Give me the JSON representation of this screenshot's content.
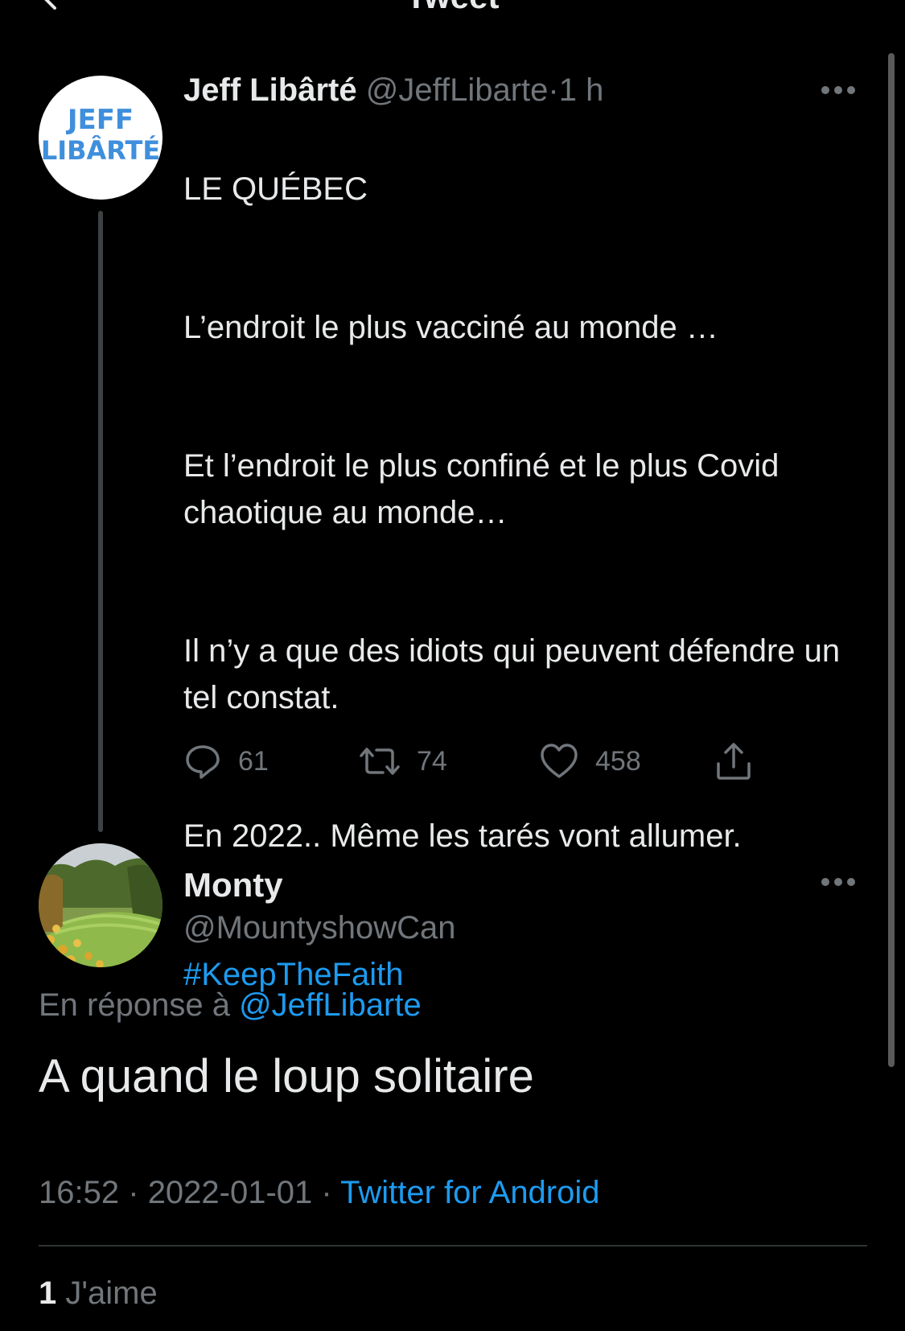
{
  "header": {
    "title": "Tweet",
    "back_icon": "chevron-left-icon"
  },
  "colors": {
    "background": "#000000",
    "text": "#e7e9ea",
    "secondary_text": "#71767b",
    "accent": "#1d9bf0",
    "divider": "#2f3336"
  },
  "parent_tweet": {
    "avatar_text_line1": "JEFF",
    "avatar_text_line2": "LIBÂRTÉ",
    "author_name": "Jeff Libârté",
    "author_handle": "@JeffLibarte",
    "separator": "·",
    "time": "1 h",
    "more_icon": "more-horizontal-icon",
    "paragraphs": [
      "LE QUÉBEC",
      "L’endroit le plus vacciné au monde …",
      "Et l’endroit le plus confiné et le plus Covid chaotique au monde…",
      "Il n’y a que des idiots qui peuvent défendre un tel constat.",
      "En 2022..  Même les tarés vont allumer."
    ],
    "hashtag": "#KeepTheFaith",
    "replies_count": "61",
    "retweets_count": "74",
    "likes_count": "458",
    "reply_icon": "reply-icon",
    "retweet_icon": "retweet-icon",
    "like_icon": "heart-icon",
    "share_icon": "share-icon"
  },
  "reply_tweet": {
    "author_name": "Monty",
    "author_handle": "@MountyshowCan",
    "more_icon": "more-horizontal-icon",
    "in_reply_to_prefix": "En réponse à",
    "in_reply_to_handle": "@JeffLibarte",
    "text": "A quand le loup solitaire",
    "time": "16:52",
    "separator": "·",
    "date": "2022-01-01",
    "source": "Twitter for Android",
    "likes_count": "1",
    "likes_label": "J'aime"
  }
}
